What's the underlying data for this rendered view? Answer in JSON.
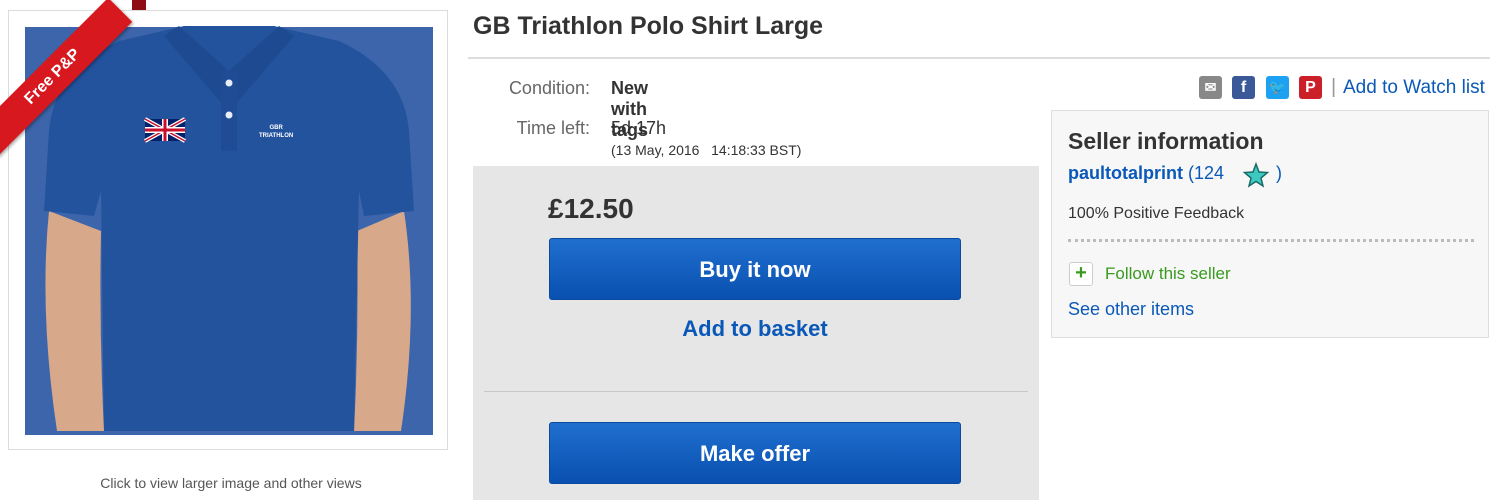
{
  "listing": {
    "title": "GB Triathlon Polo Shirt Large",
    "image_caption": "Click to view larger image and other views",
    "ribbon": "Free P&P",
    "shirt_print": "GBR\nTRIATHLON"
  },
  "details": {
    "condition_label": "Condition:",
    "condition_value": "New with tags",
    "time_label": "Time left:",
    "time_value": "5d 17h",
    "time_detail": "(13 May, 2016   14:18:33 BST)"
  },
  "purchase": {
    "price": "£12.50",
    "buy_now": "Buy it now",
    "add_to_basket": "Add to basket",
    "make_offer": "Make offer"
  },
  "share": {
    "icons": [
      "mail-icon",
      "facebook-icon",
      "twitter-icon",
      "pinterest-icon"
    ],
    "separator": "|",
    "watch_list": "Add to Watch list"
  },
  "seller": {
    "heading": "Seller information",
    "name": "paultotalprint",
    "feedback_count_open": "(124",
    "feedback_count_close": ")",
    "positive_feedback": "100% Positive Feedback",
    "follow": "Follow this seller",
    "see_other": "See other items"
  },
  "colors": {
    "button_blue": "#0a58b8",
    "ribbon_red": "#d8181f",
    "follow_green": "#3a9a1f",
    "shirt_blue": "#24539e"
  }
}
